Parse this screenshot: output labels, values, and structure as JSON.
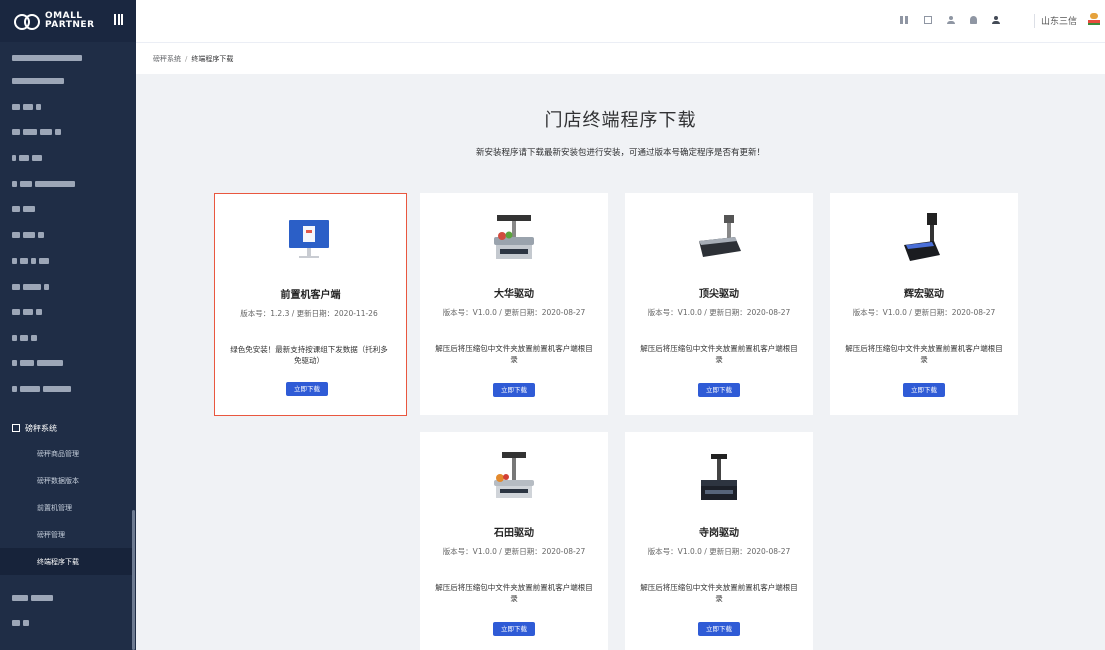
{
  "header": {
    "user_name": "山东三信"
  },
  "sidebar": {
    "logo_text_line1": "OMALL",
    "logo_text_line2": "PARTNER",
    "group_label": "磅秤系统",
    "sub_items": [
      {
        "label": "磅秤商品管理"
      },
      {
        "label": "磅秤数据版本"
      },
      {
        "label": "前置机管理"
      },
      {
        "label": "磅秤管理"
      },
      {
        "label": "终端程序下载"
      }
    ]
  },
  "breadcrumb": {
    "parent": "磅秤系统",
    "separator": "/",
    "current": "终端程序下载"
  },
  "main": {
    "title": "门店终端程序下载",
    "subtitle": "新安装程序请下载最新安装包进行安装，可通过版本号确定程序是否有更新！",
    "download_label": "立即下载",
    "cards": [
      {
        "name": "前置机客户端",
        "version": "版本号：1.2.3 / 更新日期：2020-11-26",
        "desc": "绿色免安装！最新支持按课组下发数据（托利多免驱动）",
        "icon": "monitor-icon"
      },
      {
        "name": "大华驱动",
        "version": "版本号：V1.0.0 / 更新日期：2020-08-27",
        "desc": "解压后将压缩包中文件夹放置前置机客户端根目录",
        "icon": "scale-icon"
      },
      {
        "name": "顶尖驱动",
        "version": "版本号：V1.0.0 / 更新日期：2020-08-27",
        "desc": "解压后将压缩包中文件夹放置前置机客户端根目录",
        "icon": "scale-icon"
      },
      {
        "name": "辉宏驱动",
        "version": "版本号：V1.0.0 / 更新日期：2020-08-27",
        "desc": "解压后将压缩包中文件夹放置前置机客户端根目录",
        "icon": "scale-icon"
      },
      {
        "name": "石田驱动",
        "version": "版本号：V1.0.0 / 更新日期：2020-08-27",
        "desc": "解压后将压缩包中文件夹放置前置机客户端根目录",
        "icon": "scale-icon"
      },
      {
        "name": "寺岗驱动",
        "version": "版本号：V1.0.0 / 更新日期：2020-08-27",
        "desc": "解压后将压缩包中文件夹放置前置机客户端根目录",
        "icon": "scale-icon"
      }
    ]
  },
  "colors": {
    "sidebar_bg": "#1f2d46",
    "accent": "#2f5bd6",
    "selected_border": "#e9573f"
  }
}
